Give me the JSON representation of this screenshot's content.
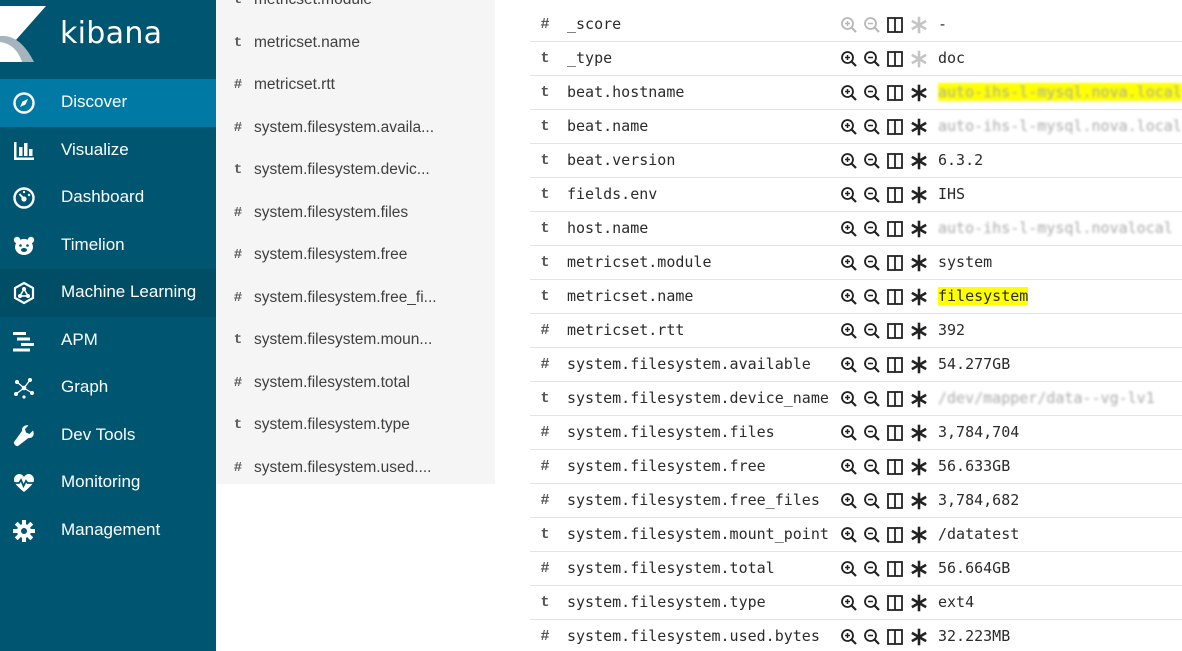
{
  "app": {
    "logo_text": "kibana"
  },
  "sidebar": {
    "items": [
      {
        "label": "Discover",
        "icon": "compass-icon",
        "state": "active"
      },
      {
        "label": "Visualize",
        "icon": "bar-chart-icon",
        "state": ""
      },
      {
        "label": "Dashboard",
        "icon": "dashboard-gauge-icon",
        "state": ""
      },
      {
        "label": "Timelion",
        "icon": "timelion-bear-icon",
        "state": ""
      },
      {
        "label": "Machine Learning",
        "icon": "machine-learning-icon",
        "state": "hover"
      },
      {
        "label": "APM",
        "icon": "apm-icon",
        "state": ""
      },
      {
        "label": "Graph",
        "icon": "graph-icon",
        "state": ""
      },
      {
        "label": "Dev Tools",
        "icon": "wrench-icon",
        "state": ""
      },
      {
        "label": "Monitoring",
        "icon": "heartbeat-icon",
        "state": ""
      },
      {
        "label": "Management",
        "icon": "gear-icon",
        "state": ""
      }
    ]
  },
  "field_list": {
    "items": [
      {
        "type": "t",
        "name": "metricset.module"
      },
      {
        "type": "t",
        "name": "metricset.name"
      },
      {
        "type": "#",
        "name": "metricset.rtt"
      },
      {
        "type": "#",
        "name": "system.filesystem.availa..."
      },
      {
        "type": "t",
        "name": "system.filesystem.devic..."
      },
      {
        "type": "#",
        "name": "system.filesystem.files"
      },
      {
        "type": "#",
        "name": "system.filesystem.free"
      },
      {
        "type": "#",
        "name": "system.filesystem.free_fi..."
      },
      {
        "type": "t",
        "name": "system.filesystem.moun..."
      },
      {
        "type": "#",
        "name": "system.filesystem.total"
      },
      {
        "type": "t",
        "name": "system.filesystem.type"
      },
      {
        "type": "#",
        "name": "system.filesystem.used...."
      }
    ]
  },
  "doc_table": {
    "rows": [
      {
        "type": "#",
        "field": "_score",
        "value": "-",
        "actions_enabled": false,
        "highlight": false,
        "redacted": false
      },
      {
        "type": "t",
        "field": "_type",
        "value": "doc",
        "actions_enabled": true,
        "highlight": false,
        "redacted": false
      },
      {
        "type": "t",
        "field": "beat.hostname",
        "value": "auto-ihs-l-mysql.nova.local",
        "actions_enabled": true,
        "highlight": true,
        "redacted": true
      },
      {
        "type": "t",
        "field": "beat.name",
        "value": "auto-ihs-l-mysql.nova.local",
        "actions_enabled": true,
        "highlight": false,
        "redacted": true
      },
      {
        "type": "t",
        "field": "beat.version",
        "value": "6.3.2",
        "actions_enabled": true,
        "highlight": false,
        "redacted": false
      },
      {
        "type": "t",
        "field": "fields.env",
        "value": "IHS",
        "actions_enabled": true,
        "highlight": false,
        "redacted": false
      },
      {
        "type": "t",
        "field": "host.name",
        "value": "auto-ihs-l-mysql.novalocal",
        "actions_enabled": true,
        "highlight": false,
        "redacted": true
      },
      {
        "type": "t",
        "field": "metricset.module",
        "value": "system",
        "actions_enabled": true,
        "highlight": false,
        "redacted": false
      },
      {
        "type": "t",
        "field": "metricset.name",
        "value": "filesystem",
        "actions_enabled": true,
        "highlight": true,
        "redacted": false
      },
      {
        "type": "#",
        "field": "metricset.rtt",
        "value": "392",
        "actions_enabled": true,
        "highlight": false,
        "redacted": false
      },
      {
        "type": "#",
        "field": "system.filesystem.available",
        "value": "54.277GB",
        "actions_enabled": true,
        "highlight": false,
        "redacted": false
      },
      {
        "type": "t",
        "field": "system.filesystem.device_name",
        "value": "/dev/mapper/data--vg-lv1",
        "actions_enabled": true,
        "highlight": false,
        "redacted": true
      },
      {
        "type": "#",
        "field": "system.filesystem.files",
        "value": "3,784,704",
        "actions_enabled": true,
        "highlight": false,
        "redacted": false
      },
      {
        "type": "#",
        "field": "system.filesystem.free",
        "value": "56.633GB",
        "actions_enabled": true,
        "highlight": false,
        "redacted": false
      },
      {
        "type": "#",
        "field": "system.filesystem.free_files",
        "value": "3,784,682",
        "actions_enabled": true,
        "highlight": false,
        "redacted": false
      },
      {
        "type": "t",
        "field": "system.filesystem.mount_point",
        "value": "/datatest",
        "actions_enabled": true,
        "highlight": false,
        "redacted": false
      },
      {
        "type": "#",
        "field": "system.filesystem.total",
        "value": "56.664GB",
        "actions_enabled": true,
        "highlight": false,
        "redacted": false
      },
      {
        "type": "t",
        "field": "system.filesystem.type",
        "value": "ext4",
        "actions_enabled": true,
        "highlight": false,
        "redacted": false
      },
      {
        "type": "#",
        "field": "system.filesystem.used.bytes",
        "value": "32.223MB",
        "actions_enabled": true,
        "highlight": false,
        "redacted": false
      }
    ],
    "action_icons": [
      "magnify-plus-icon",
      "magnify-minus-icon",
      "toggle-column-icon",
      "exists-filter-icon"
    ]
  },
  "colors": {
    "sidebar_bg": "#005571",
    "sidebar_active": "#0079a5",
    "field_list_bg": "#f5f5f5",
    "highlight": "#ffff00"
  }
}
